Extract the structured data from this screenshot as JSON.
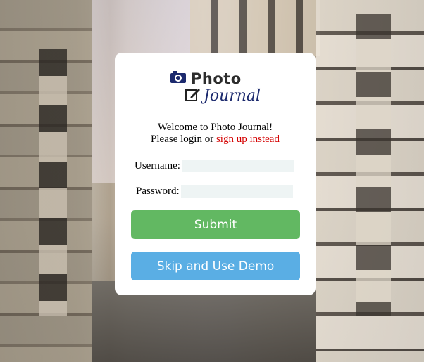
{
  "logo": {
    "photo_text": "Photo",
    "journal_text": "Journal",
    "camera_icon": "camera-icon",
    "edit_icon": "edit-icon"
  },
  "welcome": {
    "line1": "Welcome to Photo Journal!",
    "line2_prefix": "Please login or ",
    "signup_link": "sign up instead"
  },
  "form": {
    "username_label": "Username:",
    "username_value": "",
    "password_label": "Password:",
    "password_value": ""
  },
  "buttons": {
    "submit": "Submit",
    "demo": "Skip and Use Demo"
  },
  "colors": {
    "submit": "#62b862",
    "demo": "#5aaee4",
    "link": "#d40000",
    "input_bg": "#eef4f4",
    "journal": "#1c2a6e"
  }
}
